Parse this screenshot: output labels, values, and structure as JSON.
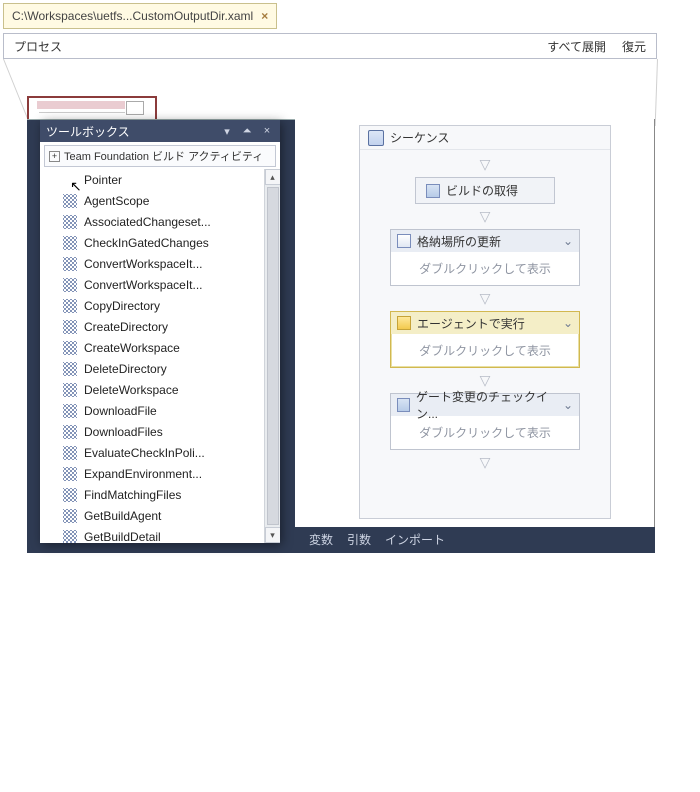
{
  "tab": {
    "filename": "C:\\Workspaces\\uetfs...CustomOutputDir.xaml"
  },
  "header": {
    "process": "プロセス",
    "expand_all": "すべて展開",
    "restore": "復元"
  },
  "toolbox": {
    "title": "ツールボックス",
    "group": "Team Foundation ビルド アクティビティ",
    "items": [
      "Pointer",
      "AgentScope",
      "AssociatedChangeset...",
      "CheckInGatedChanges",
      "ConvertWorkspaceIt...",
      "ConvertWorkspaceIt...",
      "CopyDirectory",
      "CreateDirectory",
      "CreateWorkspace",
      "DeleteDirectory",
      "DeleteWorkspace",
      "DownloadFile",
      "DownloadFiles",
      "EvaluateCheckInPoli...",
      "ExpandEnvironment...",
      "FindMatchingFiles",
      "GetBuildAgent",
      "GetBuildDetail"
    ]
  },
  "workflow": {
    "sequence_label": "シーケンス",
    "get_build": "ビルドの取得",
    "storage_update": "格納場所の更新",
    "dbl_click": "ダブルクリックして表示",
    "agent_run": "エージェントで実行",
    "gate_checkin": "ゲート変更のチェックイン..."
  },
  "bottom_tabs": {
    "vars": "変数",
    "args": "引数",
    "imports": "インポート"
  }
}
